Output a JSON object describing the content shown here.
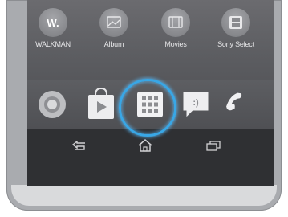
{
  "apps": [
    {
      "label": "WALKMAN",
      "icon": "walkman-icon"
    },
    {
      "label": "Album",
      "icon": "album-icon"
    },
    {
      "label": "Movies",
      "icon": "movies-icon"
    },
    {
      "label": "Sony Select",
      "icon": "sony-select-icon"
    }
  ],
  "dock": [
    {
      "icon": "chrome-icon"
    },
    {
      "icon": "play-store-icon"
    },
    {
      "icon": "app-drawer-icon"
    },
    {
      "icon": "messaging-icon"
    },
    {
      "icon": "phone-icon"
    }
  ],
  "nav": [
    {
      "icon": "back-icon"
    },
    {
      "icon": "home-icon"
    },
    {
      "icon": "recent-apps-icon"
    }
  ],
  "colors": {
    "highlight": "#39a7e6",
    "screen_bg": "#5c5d61",
    "navbar_bg": "#2f3033",
    "phone_frame": "#a9abaf"
  }
}
